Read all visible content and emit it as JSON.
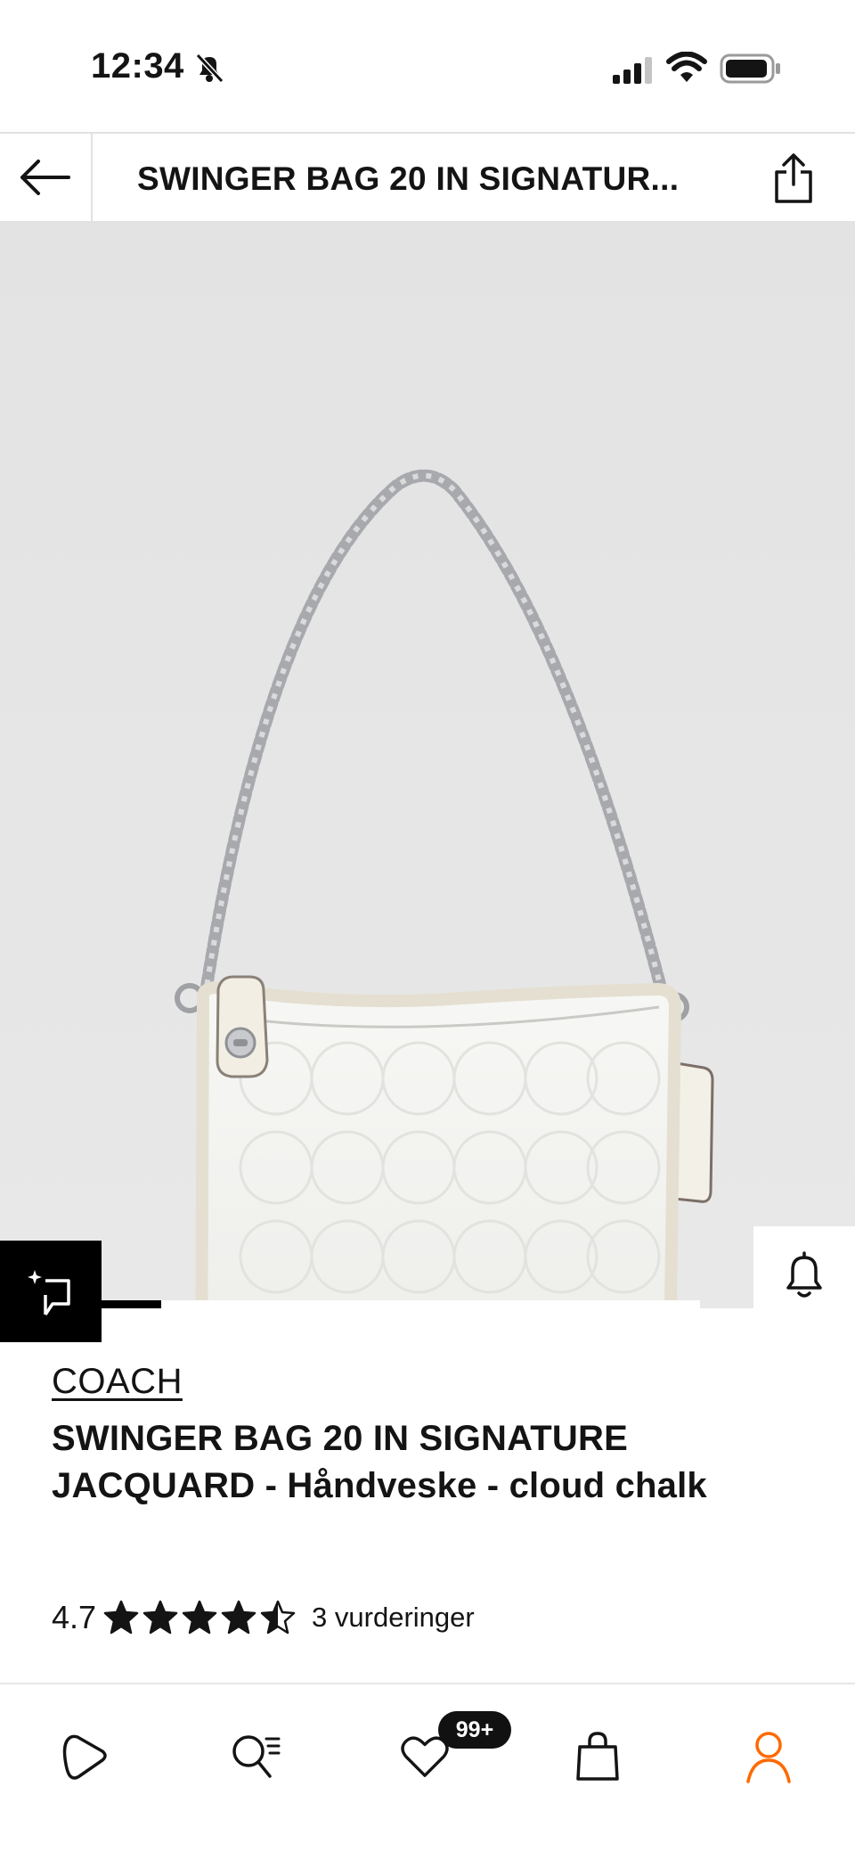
{
  "status_bar": {
    "time": "12:34",
    "icons": [
      "bell-slash-icon",
      "cellular-signal-icon",
      "wifi-icon",
      "battery-icon"
    ]
  },
  "header": {
    "back_icon": "arrow-left-icon",
    "title": "SWINGER BAG 20 IN SIGNATUR...",
    "share_icon": "share-icon"
  },
  "gallery": {
    "image_description_icon": "product-photo",
    "progress_fraction": 0.1,
    "side_actions": [
      "bell-icon",
      "heart-icon",
      "shopping-bag-icon"
    ],
    "compare_icon": "compare-icon"
  },
  "product": {
    "brand": "COACH",
    "name": "SWINGER BAG 20 IN SIGNATURE JACQUARD - Håndveske - cloud chalk",
    "rating_value": "4.7",
    "rating_numeric": 4.7,
    "rating_max": 5,
    "review_count": "3 vurderinger"
  },
  "bottom_nav": {
    "items": [
      "discover-icon",
      "search-icon",
      "heart-icon",
      "shopping-bag-icon",
      "profile-icon"
    ],
    "wishlist_badge": "99+",
    "active_color": "#ff6900"
  }
}
